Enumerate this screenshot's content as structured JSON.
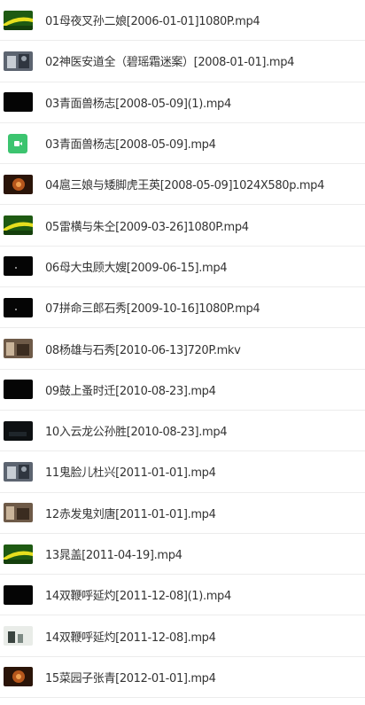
{
  "colors": {
    "text": "#333333",
    "divider": "#ececec",
    "video_icon_bg": "#3cc46f"
  },
  "files": [
    {
      "name": "01母夜叉孙二娘[2006-01-01]1080P.mp4",
      "thumb": "green-arc"
    },
    {
      "name": "02神医安道全（碧瑶霜迷案）[2008-01-01].mp4",
      "thumb": "gray-scene"
    },
    {
      "name": "03青面兽杨志[2008-05-09](1).mp4",
      "thumb": "black"
    },
    {
      "name": "03青面兽杨志[2008-05-09].mp4",
      "thumb": "video-file-icon"
    },
    {
      "name": "04扈三娘与矮脚虎王英[2008-05-09]1024X580p.mp4",
      "thumb": "brown-scene"
    },
    {
      "name": "05雷横与朱仝[2009-03-26]1080P.mp4",
      "thumb": "green-arc"
    },
    {
      "name": "06母大虫顾大嫂[2009-06-15].mp4",
      "thumb": "black-dot"
    },
    {
      "name": "07拼命三郎石秀[2009-10-16]1080P.mp4",
      "thumb": "black-dot"
    },
    {
      "name": "08杨雄与石秀[2010-06-13]720P.mkv",
      "thumb": "sepia-scene"
    },
    {
      "name": "09鼓上蚤时迁[2010-08-23].mp4",
      "thumb": "black"
    },
    {
      "name": "10入云龙公孙胜[2010-08-23].mp4",
      "thumb": "dark-scene"
    },
    {
      "name": "11鬼脸儿杜兴[2011-01-01].mp4",
      "thumb": "gray-scene"
    },
    {
      "name": "12赤发鬼刘唐[2011-01-01].mp4",
      "thumb": "sepia-scene"
    },
    {
      "name": "13晁盖[2011-04-19].mp4",
      "thumb": "green-arc"
    },
    {
      "name": "14双鞭呼延灼[2011-12-08](1).mp4",
      "thumb": "black"
    },
    {
      "name": "14双鞭呼延灼[2011-12-08].mp4",
      "thumb": "light-scene"
    },
    {
      "name": "15菜园子张青[2012-01-01].mp4",
      "thumb": "brown-scene"
    }
  ]
}
